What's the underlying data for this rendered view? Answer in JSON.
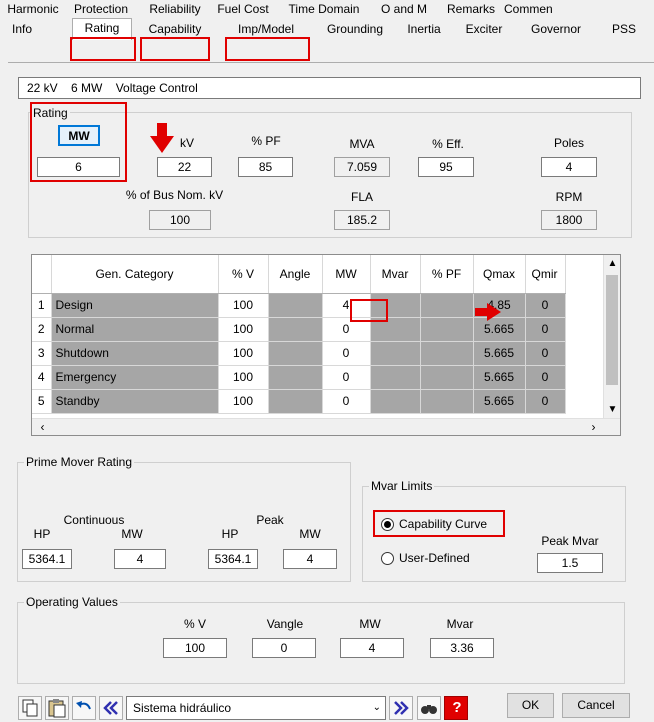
{
  "tabs_back": [
    "Harmonic",
    "Protection",
    "Reliability",
    "Fuel Cost",
    "Time Domain",
    "O and M",
    "Remarks",
    "Commen"
  ],
  "tabs_front": [
    "Info",
    "Rating",
    "Capability",
    "Imp/Model",
    "Grounding",
    "Inertia",
    "Exciter",
    "Governor",
    "PSS"
  ],
  "summary": {
    "kv": "22 kV",
    "mw": "6 MW",
    "mode": "Voltage Control"
  },
  "rating": {
    "title": "Rating",
    "mw_button": "MW",
    "mw_value": "6",
    "kv_label": "kV",
    "kv_value": "22",
    "pf_label": "% PF",
    "pf_value": "85",
    "mva_label": "MVA",
    "mva_value": "7.059",
    "eff_label": "% Eff.",
    "eff_value": "95",
    "poles_label": "Poles",
    "poles_value": "4",
    "busnom_label": "% of Bus Nom. kV",
    "busnom_value": "100",
    "fla_label": "FLA",
    "fla_value": "185.2",
    "rpm_label": "RPM",
    "rpm_value": "1800"
  },
  "grid": {
    "headers": [
      "Gen. Category",
      "% V",
      "Angle",
      "MW",
      "Mvar",
      "% PF",
      "Qmax",
      "Qmir"
    ],
    "rows": [
      {
        "n": "1",
        "cat": "Design",
        "v": "100",
        "mw": "4",
        "qmax": "4.85",
        "qmin": "0"
      },
      {
        "n": "2",
        "cat": "Normal",
        "v": "100",
        "mw": "0",
        "qmax": "5.665",
        "qmin": "0"
      },
      {
        "n": "3",
        "cat": "Shutdown",
        "v": "100",
        "mw": "0",
        "qmax": "5.665",
        "qmin": "0"
      },
      {
        "n": "4",
        "cat": "Emergency",
        "v": "100",
        "mw": "0",
        "qmax": "5.665",
        "qmin": "0"
      },
      {
        "n": "5",
        "cat": "Standby",
        "v": "100",
        "mw": "0",
        "qmax": "5.665",
        "qmin": "0"
      }
    ]
  },
  "prime_mover": {
    "title": "Prime Mover Rating",
    "continuous_label": "Continuous",
    "peak_label": "Peak",
    "hp_label": "HP",
    "mw_label": "MW",
    "cont_hp": "5364.1",
    "cont_mw": "4",
    "peak_hp": "5364.1",
    "peak_mw": "4"
  },
  "mvar_limits": {
    "title": "Mvar Limits",
    "capability_curve": "Capability Curve",
    "user_defined": "User-Defined",
    "peak_mvar_label": "Peak Mvar",
    "peak_mvar": "1.5"
  },
  "operating": {
    "title": "Operating Values",
    "v_label": "% V",
    "v_value": "100",
    "vangle_label": "Vangle",
    "vangle_value": "0",
    "mw_label": "MW",
    "mw_value": "4",
    "mvar_label": "Mvar",
    "mvar_value": "3.36"
  },
  "footer": {
    "library": "Sistema hidráulico",
    "ok": "OK",
    "cancel": "Cancel"
  },
  "colors": {
    "highlight": "#e00000",
    "grid_gray": "#a6a6a6"
  }
}
